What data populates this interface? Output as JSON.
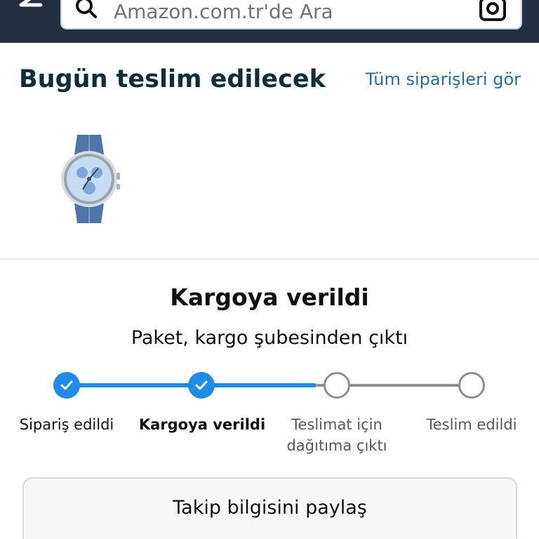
{
  "search": {
    "placeholder": "Amazon.com.tr'de Ara"
  },
  "header": {
    "title": "Bugün teslim edilecek",
    "all_orders_link": "Tüm siparişleri gör"
  },
  "product": {
    "image_icon": "smartwatch-product-image"
  },
  "status": {
    "title": "Kargoya verildi",
    "subtitle": "Paket, kargo şubesinden çıktı"
  },
  "tracker": {
    "progress_fraction": 0.5,
    "steps": [
      {
        "label": "Sipariş edildi",
        "state": "done"
      },
      {
        "label": "Kargoya verildi",
        "state": "current"
      },
      {
        "label_line1": "Teslimat için",
        "label_line2": "dağıtıma çıktı",
        "state": "pending"
      },
      {
        "label": "Teslim edildi",
        "state": "pending"
      }
    ]
  },
  "actions": {
    "share_tracking": "Takip bilgisini paylaş"
  },
  "colors": {
    "topbar": "#232f3e",
    "accent_blue": "#1f8ce6",
    "link": "#2a6aa0",
    "title": "#0f2e38",
    "pending_gray": "#8c8f8f"
  }
}
